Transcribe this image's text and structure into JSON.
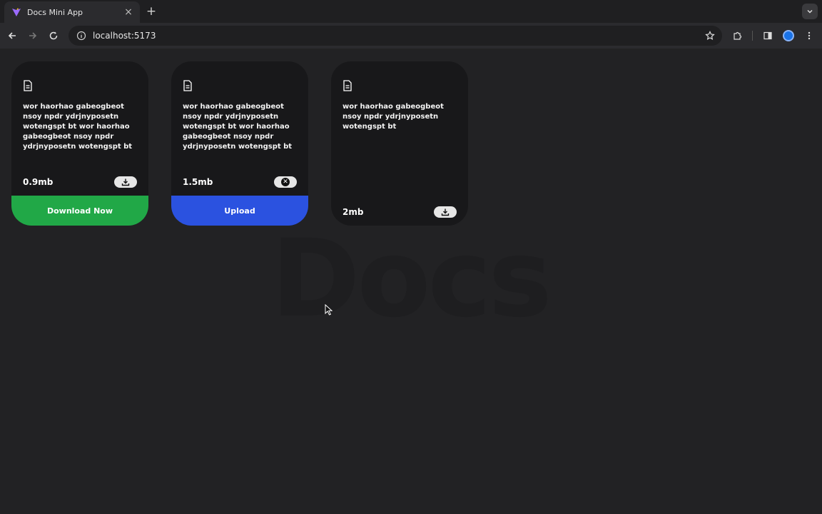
{
  "browser": {
    "tab_title": "Docs Mini App",
    "tab_close": "×",
    "new_tab": "+",
    "url": "localhost:5173"
  },
  "page": {
    "watermark": "Docs",
    "cards": [
      {
        "desc": "wor haorhao gabeogbeot nsoy npdr ydrjnyposetn wotengspt bt wor haorhao gabeogbeot nsoy npdr ydrjnyposetn wotengspt bt",
        "size": "0.9mb",
        "action_icon": "download-icon",
        "tag": {
          "open": true,
          "label": "Download Now",
          "color": "#21a847"
        }
      },
      {
        "desc": "wor haorhao gabeogbeot nsoy npdr ydrjnyposetn wotengspt bt wor haorhao gabeogbeot nsoy npdr ydrjnyposetn wotengspt bt",
        "size": "1.5mb",
        "action_icon": "close-icon",
        "tag": {
          "open": true,
          "label": "Upload",
          "color": "#2b52e0"
        }
      },
      {
        "desc": "wor haorhao gabeogbeot nsoy npdr ydrjnyposetn wotengspt bt",
        "size": "2mb",
        "action_icon": "download-icon",
        "tag": {
          "open": false,
          "label": "",
          "color": ""
        }
      }
    ]
  },
  "colors": {
    "page_bg": "#222224",
    "card_bg": "#18181a",
    "green": "#21a847",
    "blue": "#2b52e0"
  }
}
